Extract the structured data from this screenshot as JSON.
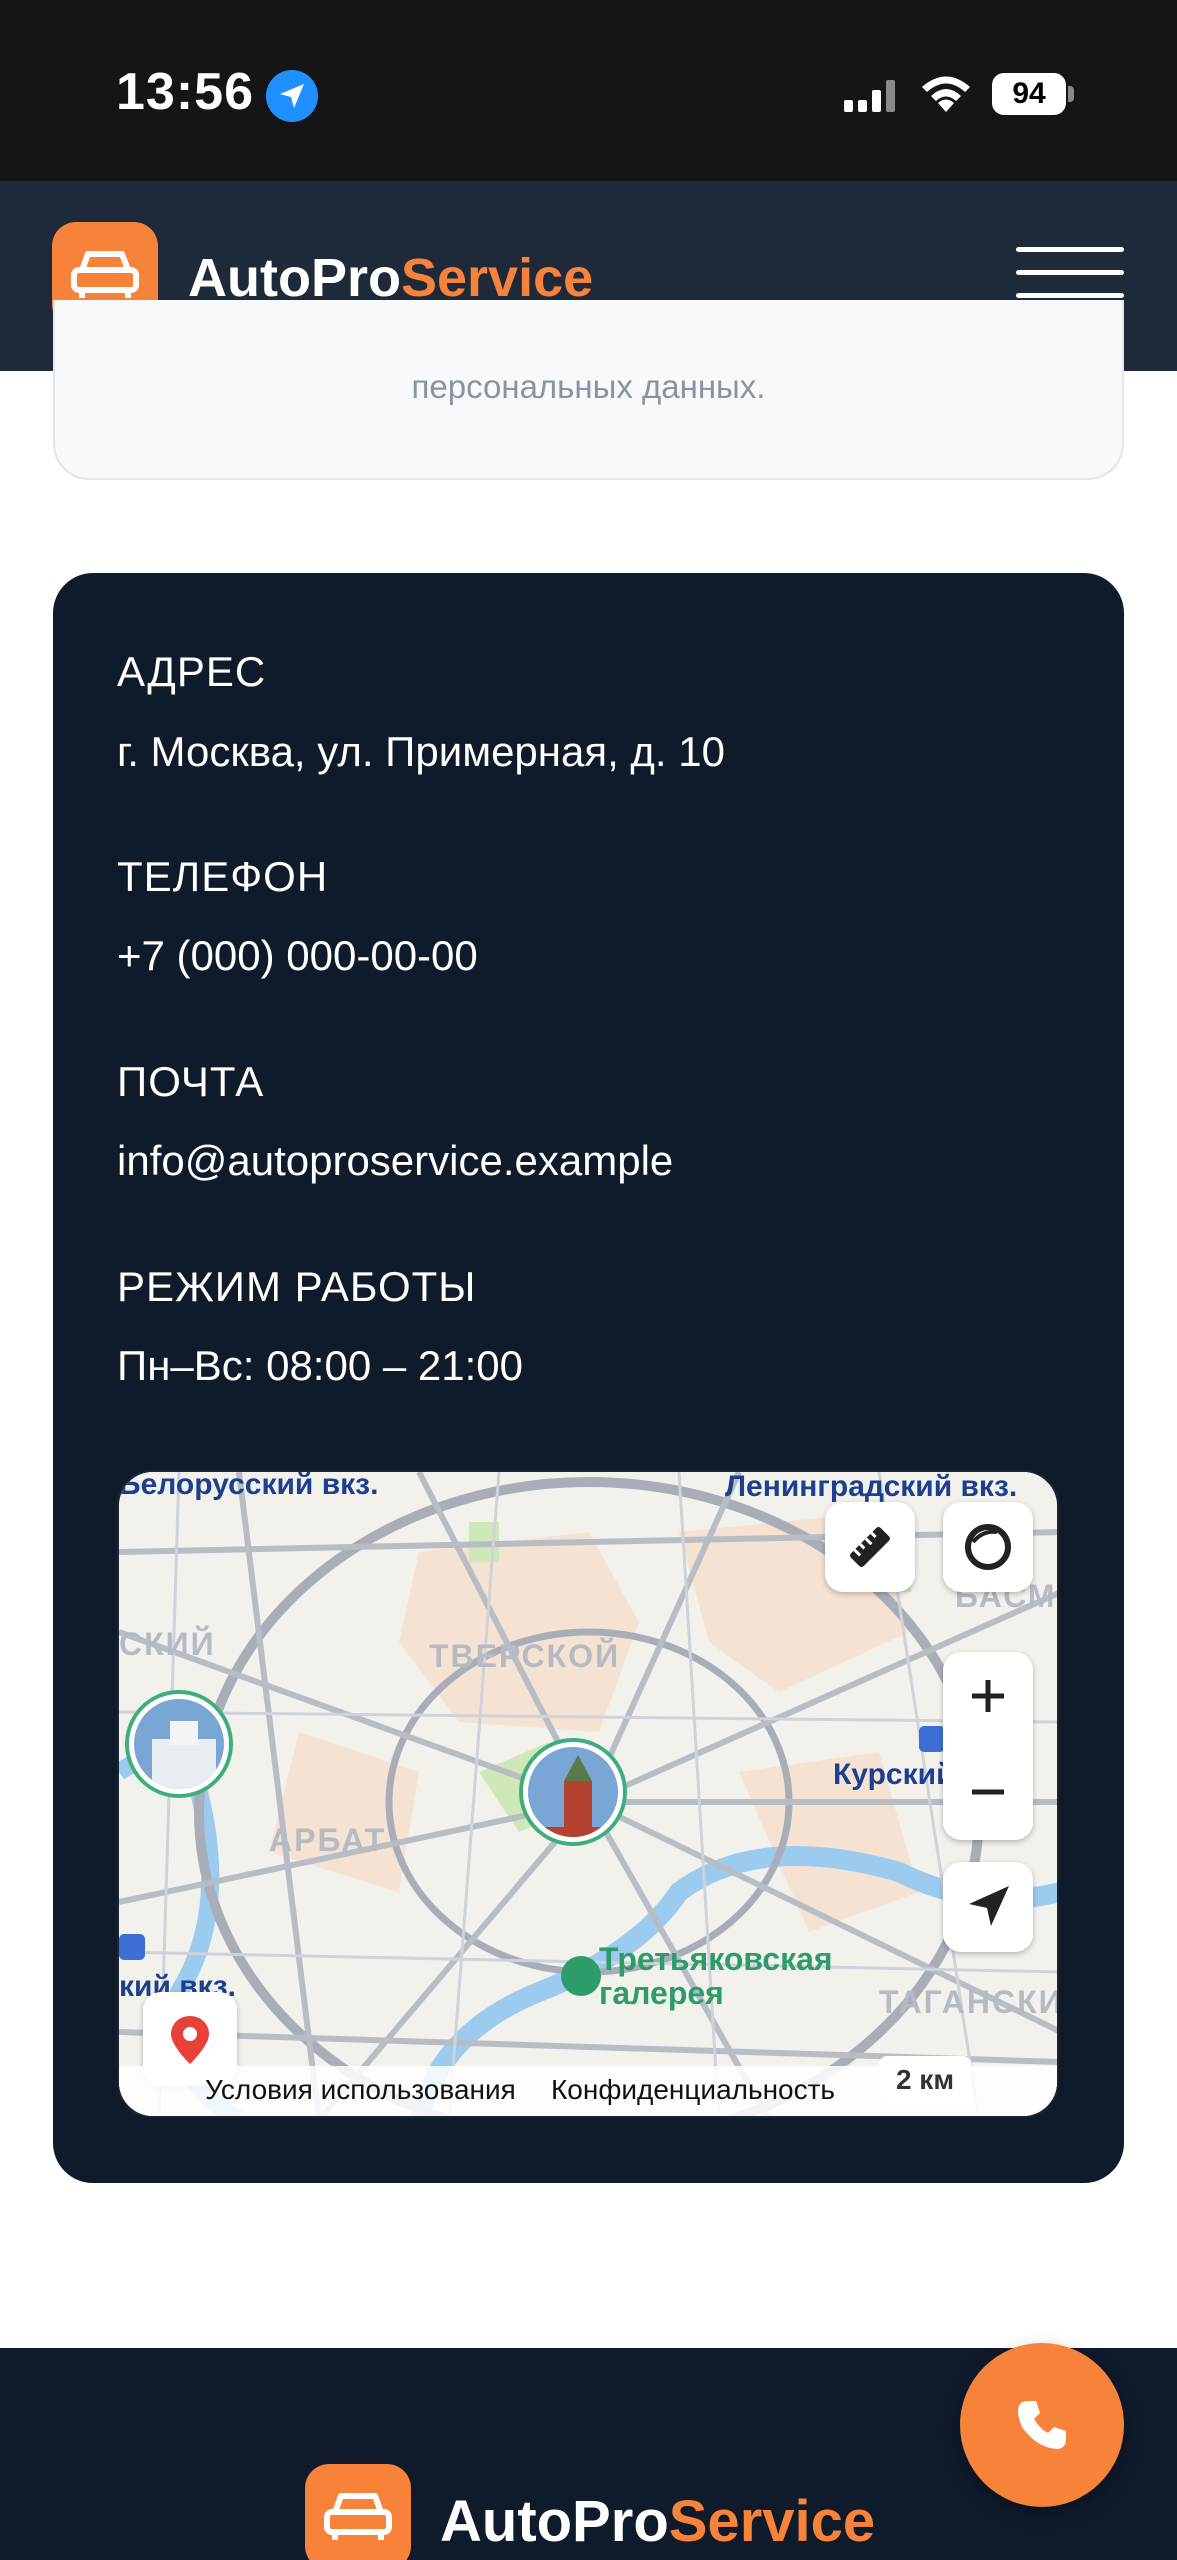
{
  "status_bar": {
    "time": "13:56",
    "battery": "94"
  },
  "header": {
    "brand_main": "AutoPro",
    "brand_accent": "Service"
  },
  "consent": {
    "text_tail": "персональных данных."
  },
  "contacts": {
    "address_label": "АДРЕС",
    "address_value": "г. Москва, ул. Примерная, д. 10",
    "phone_label": "ТЕЛЕФОН",
    "phone_value": "+7 (000) 000-00-00",
    "email_label": "ПОЧТА",
    "email_value": "info@autoproservice.example",
    "hours_label": "РЕЖИМ РАБОТЫ",
    "hours_value": "Пн–Вс: 08:00 – 21:00"
  },
  "map": {
    "labels": {
      "belorussky": "Белорусский вкз.",
      "leningradsky": "Ленинградский вкз.",
      "tverskoy": "ТВЕРСКОЙ",
      "arbat": "АРБАТ",
      "kursky": "Курский",
      "taganskiy": "ТАГАНСКИЙ",
      "basmanny": "БАСМАН",
      "kievsky": "кий вкз.",
      "skiy": "СКИЙ",
      "gallery_line1": "Третьяковская",
      "gallery_line2": "галерея"
    },
    "terms": "Условия использования",
    "privacy": "Конфиденциальность",
    "scale": "2 км"
  },
  "footer": {
    "brand_main": "AutoPro",
    "brand_accent": "Service"
  },
  "colors": {
    "accent": "#f7823a",
    "header_bg": "#1e2a3a",
    "card_bg": "#0f1a2b"
  }
}
